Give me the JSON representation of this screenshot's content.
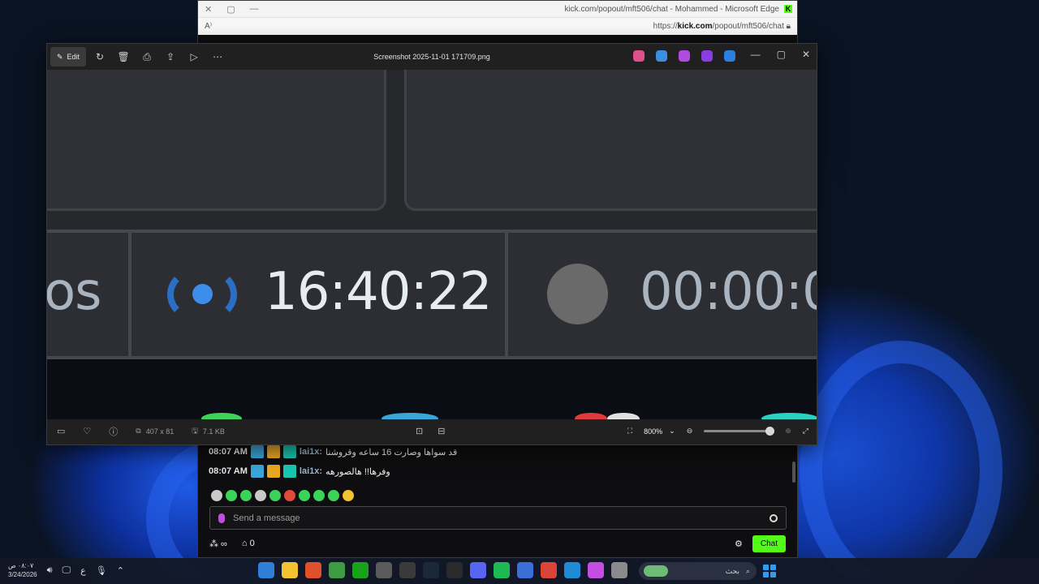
{
  "edge": {
    "title": "kick.com/popout/mft506/chat - Mohammed - Microsoft Edge",
    "url_prefix": "https://",
    "url_domain": "kick.com",
    "url_path": "/popout/mft506/chat",
    "brand_color": "#53fc18"
  },
  "chat": {
    "messages": [
      {
        "time": "08:07 AM",
        "user": "lai1x:",
        "text": "قد سواها وصارت 16 ساعه وقروشنا"
      },
      {
        "time": "08:07 AM",
        "user": "lai1x:",
        "text": "وفرها!! هالصورهه"
      }
    ],
    "input_placeholder": "Send a message",
    "follower_count": "0",
    "chat_button": "Chat"
  },
  "photos": {
    "toolbar": {
      "edit_label": "Edit"
    },
    "file_name": "Screenshot 2025-11-01 171709.png",
    "image_content": {
      "text_partial_left": "os",
      "live_time": "16:40:22",
      "rec_time": "00:00:0"
    },
    "status": {
      "dimensions": "407 x 81",
      "file_size": "7.1 KB",
      "zoom": "800%",
      "zoom_slider_fraction": 0.95
    }
  },
  "taskbar": {
    "time": "٠٨:٠٧ ص",
    "date": "3/24/2026",
    "lang": "ع",
    "search_label": "بحث"
  }
}
